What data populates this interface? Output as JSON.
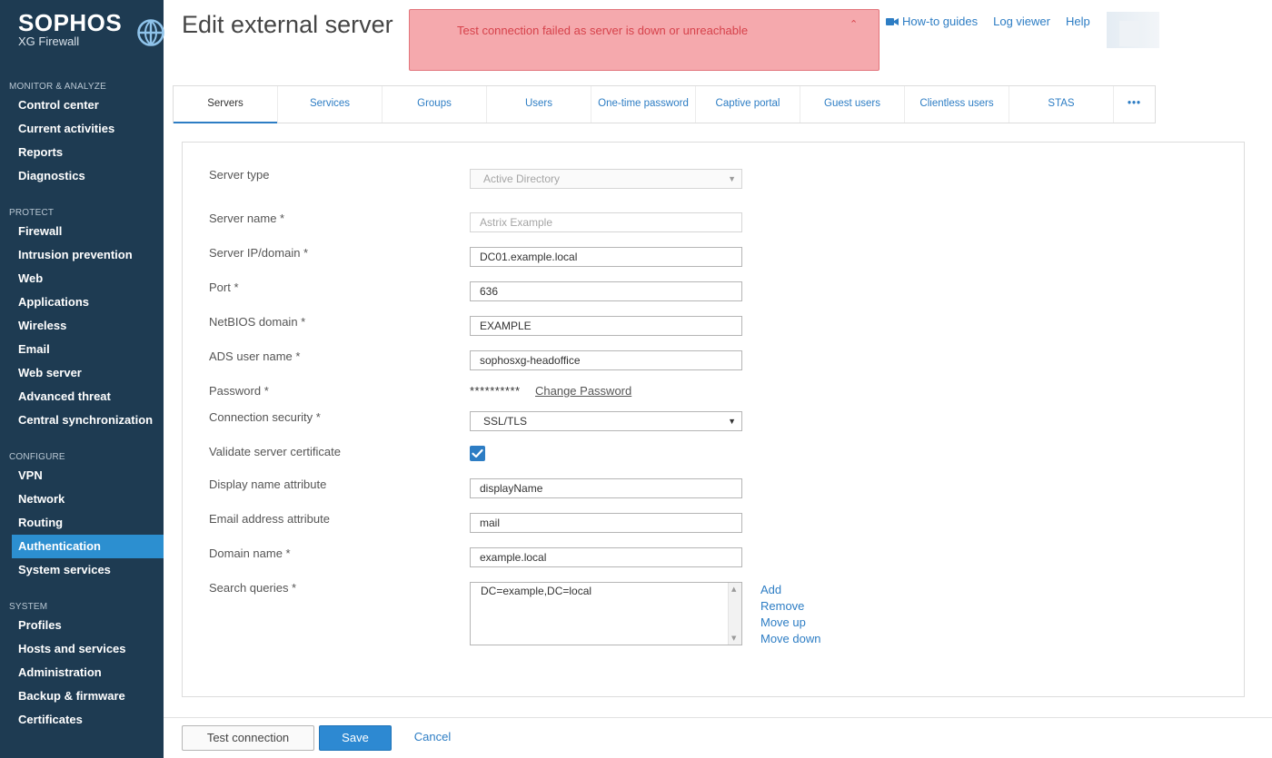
{
  "brand": {
    "name": "SOPHOS",
    "product": "XG Firewall"
  },
  "nav": [
    {
      "heading": "MONITOR & ANALYZE",
      "items": [
        "Control center",
        "Current activities",
        "Reports",
        "Diagnostics"
      ]
    },
    {
      "heading": "PROTECT",
      "items": [
        "Firewall",
        "Intrusion prevention",
        "Web",
        "Applications",
        "Wireless",
        "Email",
        "Web server",
        "Advanced threat",
        "Central synchronization"
      ]
    },
    {
      "heading": "CONFIGURE",
      "items": [
        "VPN",
        "Network",
        "Routing",
        "Authentication",
        "System services"
      ]
    },
    {
      "heading": "SYSTEM",
      "items": [
        "Profiles",
        "Hosts and services",
        "Administration",
        "Backup & firmware",
        "Certificates"
      ]
    }
  ],
  "active_nav": "Authentication",
  "header": {
    "title": "Edit external server",
    "alert": "Test connection failed as server is down or unreachable",
    "links": {
      "howto": "How-to guides",
      "log": "Log viewer",
      "help": "Help"
    }
  },
  "tabs": [
    "Servers",
    "Services",
    "Groups",
    "Users",
    "One-time password",
    "Captive portal",
    "Guest users",
    "Clientless users",
    "STAS",
    "•••"
  ],
  "form": {
    "server_type": {
      "label": "Server type",
      "value": "Active Directory"
    },
    "server_name": {
      "label": "Server name *",
      "placeholder": "Astrix Example"
    },
    "server_ip": {
      "label": "Server IP/domain *",
      "value": "DC01.example.local"
    },
    "port": {
      "label": "Port *",
      "value": "636"
    },
    "netbios": {
      "label": "NetBIOS domain *",
      "value": "EXAMPLE"
    },
    "ads_user": {
      "label": "ADS user name *",
      "value": "sophosxg-headoffice"
    },
    "password": {
      "label": "Password *",
      "mask": "**********",
      "change": "Change Password"
    },
    "conn_security": {
      "label": "Connection security *",
      "value": "SSL/TLS"
    },
    "validate_cert": {
      "label": "Validate server certificate",
      "checked": true
    },
    "display_attr": {
      "label": "Display name attribute",
      "value": "displayName"
    },
    "email_attr": {
      "label": "Email address attribute",
      "value": "mail"
    },
    "domain_name": {
      "label": "Domain name *",
      "value": "example.local"
    },
    "search_queries": {
      "label": "Search queries *",
      "value": "DC=example,DC=local"
    },
    "list_actions": {
      "add": "Add",
      "remove": "Remove",
      "up": "Move up",
      "down": "Move down"
    }
  },
  "footer": {
    "test": "Test connection",
    "save": "Save",
    "cancel": "Cancel"
  },
  "colors": {
    "sidebar": "#1e3b52",
    "accent": "#2d7dc4",
    "active_nav": "#2c8fd0",
    "alert_bg": "#f5a9ad",
    "alert_text": "#d6424b"
  }
}
